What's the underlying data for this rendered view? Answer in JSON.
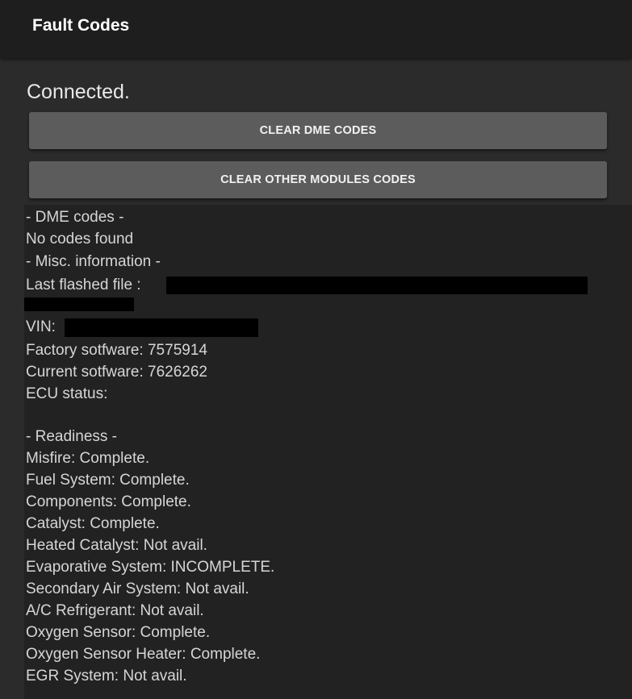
{
  "header": {
    "title": "Fault Codes"
  },
  "status_text": "Connected.",
  "buttons": {
    "clear_dme": "CLEAR DME CODES",
    "clear_other": "CLEAR OTHER MODULES CODES"
  },
  "output": {
    "dme_header": " - DME codes -",
    "no_codes": "No codes found",
    "misc_header": " - Misc. information -",
    "last_flashed_label": "Last flashed file :",
    "vin_label": "VIN:",
    "factory_software": "Factory sotfware: 7575914",
    "current_software": "Current sotfware: 7626262",
    "ecu_status": "ECU status:",
    "readiness_header": " - Readiness -",
    "readiness": [
      "Misfire: Complete.",
      "Fuel System: Complete.",
      "Components: Complete.",
      "Catalyst: Complete.",
      "Heated Catalyst: Not avail.",
      "Evaporative System: INCOMPLETE.",
      "Secondary Air System: Not avail.",
      "A/C Refrigerant: Not avail.",
      "Oxygen Sensor: Complete.",
      "Oxygen Sensor Heater: Complete.",
      "EGR System: Not avail."
    ]
  }
}
